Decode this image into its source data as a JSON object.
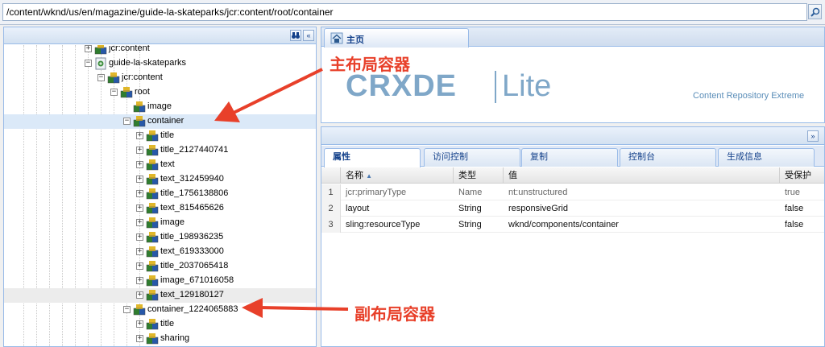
{
  "address_bar": {
    "path": "/content/wknd/us/en/magazine/guide-la-skateparks/jcr:content/root/container",
    "go_icon": "search-icon"
  },
  "tree": {
    "toolbar_icons": [
      "binoculars-icon",
      "collapse-left-icon"
    ],
    "nodes": [
      {
        "label": "jcr:content",
        "depth": 4,
        "expander": "+",
        "icon": "node-icon",
        "state": ""
      },
      {
        "label": "guide-la-skateparks",
        "depth": 4,
        "expander": "−",
        "icon": "page-icon",
        "state": ""
      },
      {
        "label": "jcr:content",
        "depth": 5,
        "expander": "−",
        "icon": "node-icon",
        "state": ""
      },
      {
        "label": "root",
        "depth": 6,
        "expander": "−",
        "icon": "node-icon",
        "state": ""
      },
      {
        "label": "image",
        "depth": 7,
        "expander": "",
        "icon": "node-icon",
        "state": ""
      },
      {
        "label": "container",
        "depth": 7,
        "expander": "−",
        "icon": "node-icon",
        "state": "selected"
      },
      {
        "label": "title",
        "depth": 8,
        "expander": "+",
        "icon": "node-icon",
        "state": ""
      },
      {
        "label": "title_2127440741",
        "depth": 8,
        "expander": "+",
        "icon": "node-icon",
        "state": ""
      },
      {
        "label": "text",
        "depth": 8,
        "expander": "+",
        "icon": "node-icon",
        "state": ""
      },
      {
        "label": "text_312459940",
        "depth": 8,
        "expander": "+",
        "icon": "node-icon",
        "state": ""
      },
      {
        "label": "title_1756138806",
        "depth": 8,
        "expander": "+",
        "icon": "node-icon",
        "state": ""
      },
      {
        "label": "text_815465626",
        "depth": 8,
        "expander": "+",
        "icon": "node-icon",
        "state": ""
      },
      {
        "label": "image",
        "depth": 8,
        "expander": "+",
        "icon": "node-icon",
        "state": ""
      },
      {
        "label": "title_198936235",
        "depth": 8,
        "expander": "+",
        "icon": "node-icon",
        "state": ""
      },
      {
        "label": "text_619333000",
        "depth": 8,
        "expander": "+",
        "icon": "node-icon",
        "state": ""
      },
      {
        "label": "title_2037065418",
        "depth": 8,
        "expander": "+",
        "icon": "node-icon",
        "state": ""
      },
      {
        "label": "image_671016058",
        "depth": 8,
        "expander": "+",
        "icon": "node-icon",
        "state": ""
      },
      {
        "label": "text_129180127",
        "depth": 8,
        "expander": "+",
        "icon": "node-icon",
        "state": "hover"
      },
      {
        "label": "container_1224065883",
        "depth": 7,
        "expander": "−",
        "icon": "node-icon",
        "state": ""
      },
      {
        "label": "title",
        "depth": 8,
        "expander": "+",
        "icon": "node-icon",
        "state": ""
      },
      {
        "label": "sharing",
        "depth": 8,
        "expander": "+",
        "icon": "node-icon",
        "state": ""
      }
    ]
  },
  "top_panel": {
    "tab_label": "主页",
    "tab_icon": "home-icon",
    "logo_crx": "CRXDE",
    "logo_lite": "Lite",
    "tagline": "Content Repository Extreme"
  },
  "bottom_panel": {
    "collapse_icon": "chevron-double-down-icon",
    "tabs": [
      "属性",
      "访问控制",
      "复制",
      "控制台",
      "生成信息"
    ],
    "active_tab": 0,
    "columns": [
      "名称",
      "类型",
      "值",
      "受保护"
    ],
    "sort_indicator": "▲",
    "rows": [
      {
        "num": "1",
        "name": "jcr:primaryType",
        "type": "Name",
        "value": "nt:unstructured",
        "protected": "true",
        "muted": true
      },
      {
        "num": "2",
        "name": "layout",
        "type": "String",
        "value": "responsiveGrid",
        "protected": "false",
        "muted": false
      },
      {
        "num": "3",
        "name": "sling:resourceType",
        "type": "String",
        "value": "wknd/components/container",
        "protected": "false",
        "muted": false
      }
    ]
  },
  "annotations": {
    "primary": "主布局容器",
    "secondary": "副布局容器",
    "color": "#e8402a"
  }
}
